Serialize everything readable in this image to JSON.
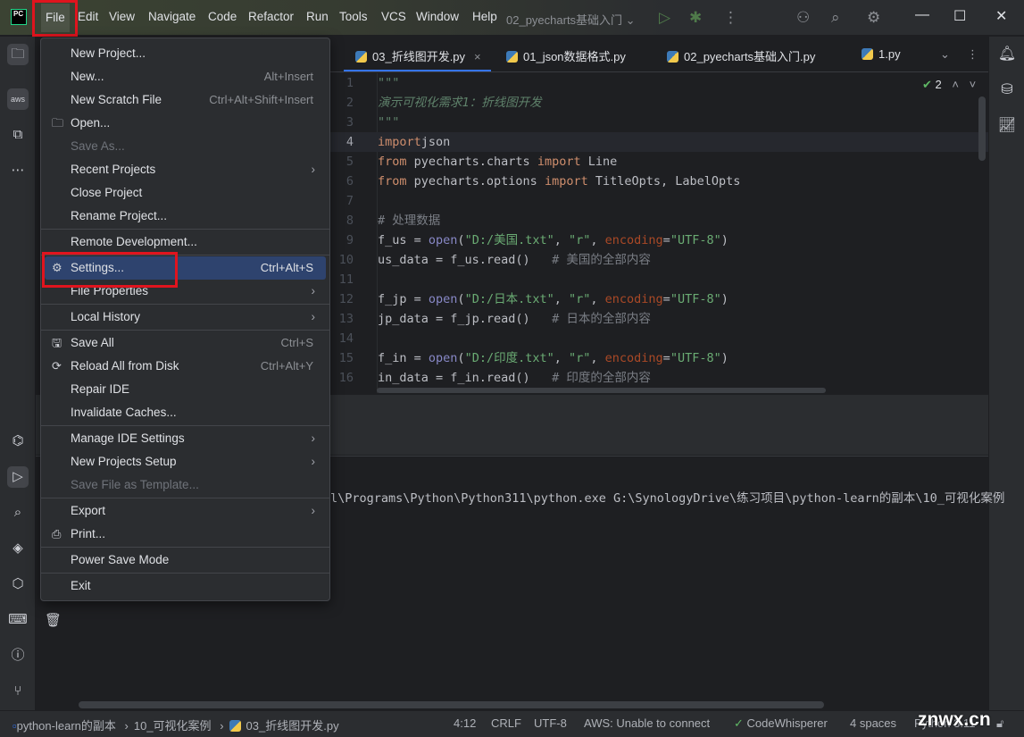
{
  "titlebar": {
    "logo": "PC",
    "menus": [
      "File",
      "Edit",
      "View",
      "Navigate",
      "Code",
      "Refactor",
      "Run",
      "Tools",
      "VCS",
      "Window",
      "Help"
    ],
    "project": "02_pyecharts基础入门 ⌄",
    "icons": [
      "run-icon",
      "debug-icon",
      "more-icon",
      "add-user-icon",
      "search-icon",
      "settings-icon"
    ]
  },
  "tabs": [
    {
      "label": "03_折线图开发.py",
      "active": true
    },
    {
      "label": "01_json数据格式.py"
    },
    {
      "label": "02_pyecharts基础入门.py"
    },
    {
      "label": "1.py"
    }
  ],
  "inspection": {
    "count": "2"
  },
  "file_menu": [
    {
      "label": "New Project..."
    },
    {
      "label": "New...",
      "shortcut": "Alt+Insert"
    },
    {
      "label": "New Scratch File",
      "shortcut": "Ctrl+Alt+Shift+Insert"
    },
    {
      "label": "Open...",
      "icon": "folder-icon"
    },
    {
      "label": "Save As...",
      "disabled": true
    },
    {
      "label": "Recent Projects",
      "submenu": true
    },
    {
      "label": "Close Project"
    },
    {
      "label": "Rename Project..."
    },
    {
      "separator": true
    },
    {
      "label": "Remote Development..."
    },
    {
      "separator": true
    },
    {
      "label": "Settings...",
      "shortcut": "Ctrl+Alt+S",
      "icon": "gear-icon",
      "selected": true
    },
    {
      "label": "File Properties",
      "submenu": true
    },
    {
      "separator": true
    },
    {
      "label": "Local History",
      "submenu": true
    },
    {
      "separator": true
    },
    {
      "label": "Save All",
      "shortcut": "Ctrl+S",
      "icon": "save-icon"
    },
    {
      "label": "Reload All from Disk",
      "shortcut": "Ctrl+Alt+Y",
      "icon": "reload-icon"
    },
    {
      "label": "Repair IDE"
    },
    {
      "label": "Invalidate Caches..."
    },
    {
      "separator": true
    },
    {
      "label": "Manage IDE Settings",
      "submenu": true
    },
    {
      "label": "New Projects Setup",
      "submenu": true
    },
    {
      "label": "Save File as Template...",
      "disabled": true
    },
    {
      "separator": true
    },
    {
      "label": "Export",
      "submenu": true
    },
    {
      "label": "Print...",
      "icon": "print-icon"
    },
    {
      "separator": true
    },
    {
      "label": "Power Save Mode"
    },
    {
      "separator": true
    },
    {
      "label": "Exit"
    }
  ],
  "code": [
    [
      [
        "doc",
        "\"\"\""
      ]
    ],
    [
      [
        "doc",
        "演示可视化需求1：折线图开发"
      ]
    ],
    [
      [
        "doc",
        "\"\"\""
      ]
    ],
    [
      [
        "kw",
        "import"
      ],
      [
        "",
        "json"
      ]
    ],
    [
      [
        "kw",
        "from"
      ],
      [
        "",
        " pyecharts.charts "
      ],
      [
        "kw",
        "import"
      ],
      [
        "",
        " Line"
      ]
    ],
    [
      [
        "kw",
        "from"
      ],
      [
        "",
        " pyecharts.options "
      ],
      [
        "kw",
        "import"
      ],
      [
        "",
        " TitleOpts, LabelOpts"
      ]
    ],
    [],
    [
      [
        "cm",
        "# 处理数据"
      ]
    ],
    [
      [
        "",
        "f_us = "
      ],
      [
        "fn",
        "open"
      ],
      [
        "",
        "("
      ],
      [
        "str",
        "\"D:/美国.txt\""
      ],
      [
        "",
        ", "
      ],
      [
        "str",
        "\"r\""
      ],
      [
        "",
        ", "
      ],
      [
        "param",
        "encoding"
      ],
      [
        "",
        "="
      ],
      [
        "str",
        "\"UTF-8\""
      ],
      [
        "",
        ")"
      ]
    ],
    [
      [
        "",
        "us_data = f_us.read()   "
      ],
      [
        "cm",
        "# 美国的全部内容"
      ]
    ],
    [],
    [
      [
        "",
        "f_jp = "
      ],
      [
        "fn",
        "open"
      ],
      [
        "",
        "("
      ],
      [
        "str",
        "\"D:/日本.txt\""
      ],
      [
        "",
        ", "
      ],
      [
        "str",
        "\"r\""
      ],
      [
        "",
        ", "
      ],
      [
        "param",
        "encoding"
      ],
      [
        "",
        "="
      ],
      [
        "str",
        "\"UTF-8\""
      ],
      [
        "",
        ")"
      ]
    ],
    [
      [
        "",
        "jp_data = f_jp.read()   "
      ],
      [
        "cm",
        "# 日本的全部内容"
      ]
    ],
    [],
    [
      [
        "",
        "f_in = "
      ],
      [
        "fn",
        "open"
      ],
      [
        "",
        "("
      ],
      [
        "str",
        "\"D:/印度.txt\""
      ],
      [
        "",
        ", "
      ],
      [
        "str",
        "\"r\""
      ],
      [
        "",
        ", "
      ],
      [
        "param",
        "encoding"
      ],
      [
        "",
        "="
      ],
      [
        "str",
        "\"UTF-8\""
      ],
      [
        "",
        ")"
      ]
    ],
    [
      [
        "",
        "in_data = f_in.read()   "
      ],
      [
        "cm",
        "# 印度的全部内容"
      ]
    ]
  ],
  "current_line": 4,
  "run_output": "l\\Programs\\Python\\Python311\\python.exe G:\\SynologyDrive\\练习项目\\python-learn的副本\\10_可视化案例",
  "status": {
    "breadcrumb": [
      "python-learn的副本",
      "10_可视化案例",
      "03_折线图开发.py"
    ],
    "position": "4:12",
    "line_sep": "CRLF",
    "encoding": "UTF-8",
    "aws": "AWS: Unable to connect",
    "codewhisperer": "CodeWhisperer",
    "indent": "4 spaces",
    "interpreter": "Python 3.11",
    "watermark": "znwx.cn"
  },
  "colors": {
    "accent": "#3574f0",
    "selection": "#2e436e",
    "highlight_box": "#e0141e"
  }
}
